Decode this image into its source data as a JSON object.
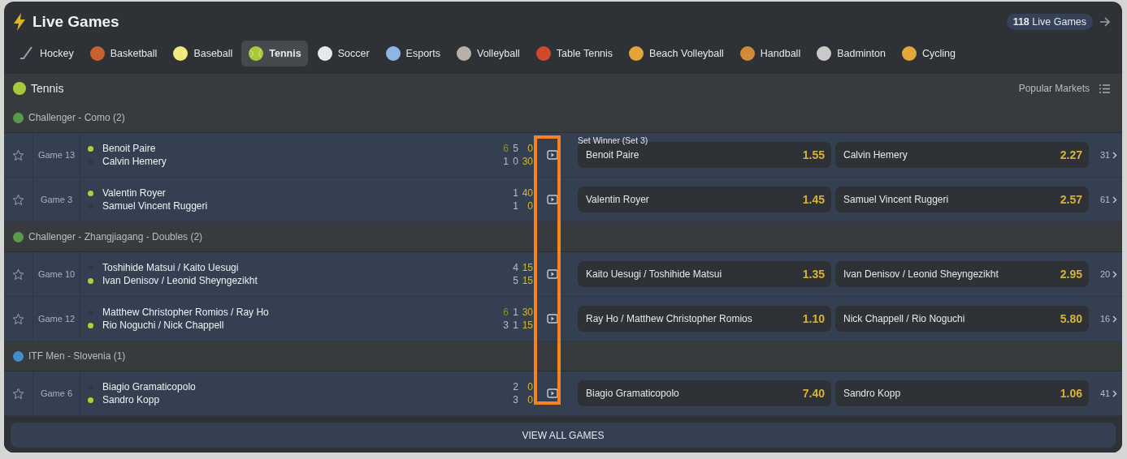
{
  "header": {
    "title": "Live Games",
    "live_count": {
      "count": "118",
      "label": "Live Games"
    }
  },
  "tabs": [
    {
      "label": "Hockey",
      "selected": false
    },
    {
      "label": "Basketball",
      "selected": false
    },
    {
      "label": "Baseball",
      "selected": false
    },
    {
      "label": "Tennis",
      "selected": true
    },
    {
      "label": "Soccer",
      "selected": false
    },
    {
      "label": "Esports",
      "selected": false
    },
    {
      "label": "Volleyball",
      "selected": false
    },
    {
      "label": "Table Tennis",
      "selected": false
    },
    {
      "label": "Beach Volleyball",
      "selected": false
    },
    {
      "label": "Handball",
      "selected": false
    },
    {
      "label": "Badminton",
      "selected": false
    },
    {
      "label": "Cycling",
      "selected": false
    }
  ],
  "section": {
    "title": "Tennis",
    "markets_label": "Popular Markets"
  },
  "market_title": "Set Winner (Set 3)",
  "leagues": [
    {
      "name": "Challenger - Como (2)",
      "matches": [
        {
          "game": "Game 13",
          "players": [
            {
              "name": "Benoit Paire",
              "serving": true,
              "scores": [
                {
                  "value": "6",
                  "kind": "set_won"
                },
                {
                  "value": "5",
                  "kind": "set"
                },
                {
                  "value": "0",
                  "kind": "points"
                }
              ]
            },
            {
              "name": "Calvin Hemery",
              "serving": false,
              "scores": [
                {
                  "value": "1",
                  "kind": "set"
                },
                {
                  "value": "0",
                  "kind": "set"
                },
                {
                  "value": "30",
                  "kind": "points"
                }
              ]
            }
          ],
          "odds": [
            {
              "name": "Benoit Paire",
              "price": "1.55"
            },
            {
              "name": "Calvin Hemery",
              "price": "2.27"
            }
          ],
          "more": "31"
        },
        {
          "game": "Game 3",
          "players": [
            {
              "name": "Valentin Royer",
              "serving": true,
              "scores": [
                {
                  "value": "1",
                  "kind": "set"
                },
                {
                  "value": "40",
                  "kind": "points"
                }
              ]
            },
            {
              "name": "Samuel Vincent Ruggeri",
              "serving": false,
              "scores": [
                {
                  "value": "1",
                  "kind": "set"
                },
                {
                  "value": "0",
                  "kind": "points"
                }
              ]
            }
          ],
          "odds": [
            {
              "name": "Valentin Royer",
              "price": "1.45"
            },
            {
              "name": "Samuel Vincent Ruggeri",
              "price": "2.57"
            }
          ],
          "more": "61"
        }
      ]
    },
    {
      "name": "Challenger - Zhangjiagang - Doubles (2)",
      "matches": [
        {
          "game": "Game 10",
          "players": [
            {
              "name": "Toshihide Matsui / Kaito Uesugi",
              "serving": false,
              "scores": [
                {
                  "value": "4",
                  "kind": "set"
                },
                {
                  "value": "15",
                  "kind": "points"
                }
              ]
            },
            {
              "name": "Ivan Denisov / Leonid Sheyngezikht",
              "serving": true,
              "scores": [
                {
                  "value": "5",
                  "kind": "set"
                },
                {
                  "value": "15",
                  "kind": "points"
                }
              ]
            }
          ],
          "odds": [
            {
              "name": "Kaito Uesugi / Toshihide Matsui",
              "price": "1.35"
            },
            {
              "name": "Ivan Denisov / Leonid Sheyngezikht",
              "price": "2.95"
            }
          ],
          "more": "20"
        },
        {
          "game": "Game 12",
          "players": [
            {
              "name": "Matthew Christopher Romios / Ray Ho",
              "serving": false,
              "scores": [
                {
                  "value": "6",
                  "kind": "set_won"
                },
                {
                  "value": "1",
                  "kind": "set"
                },
                {
                  "value": "30",
                  "kind": "points"
                }
              ]
            },
            {
              "name": "Rio Noguchi / Nick Chappell",
              "serving": true,
              "scores": [
                {
                  "value": "3",
                  "kind": "set"
                },
                {
                  "value": "1",
                  "kind": "set"
                },
                {
                  "value": "15",
                  "kind": "points"
                }
              ]
            }
          ],
          "odds": [
            {
              "name": "Ray Ho / Matthew Christopher Romios",
              "price": "1.10"
            },
            {
              "name": "Nick Chappell / Rio Noguchi",
              "price": "5.80"
            }
          ],
          "more": "16"
        }
      ]
    },
    {
      "name": "ITF Men - Slovenia (1)",
      "matches": [
        {
          "game": "Game 6",
          "players": [
            {
              "name": "Biagio Gramaticopolo",
              "serving": false,
              "scores": [
                {
                  "value": "2",
                  "kind": "set"
                },
                {
                  "value": "0",
                  "kind": "points"
                }
              ]
            },
            {
              "name": "Sandro Kopp",
              "serving": true,
              "scores": [
                {
                  "value": "3",
                  "kind": "set"
                },
                {
                  "value": "0",
                  "kind": "points"
                }
              ]
            }
          ],
          "odds": [
            {
              "name": "Biagio Gramaticopolo",
              "price": "7.40"
            },
            {
              "name": "Sandro Kopp",
              "price": "1.06"
            }
          ],
          "more": "41"
        }
      ]
    }
  ],
  "view_all": "VIEW ALL GAMES"
}
